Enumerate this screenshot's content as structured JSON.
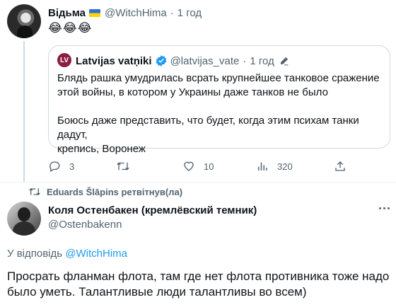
{
  "tweet": {
    "author_name": "Відьма",
    "handle": "@WitchHima",
    "dot": "·",
    "time": "1 год",
    "text": "😂😂😂",
    "quote": {
      "avatar_text": "LV",
      "author_name": "Latvijas vatņiki",
      "handle": "@latvijas_vate",
      "dot": "·",
      "time": "1 год",
      "text": "Блядь рашка умудрилась всрать крупнейшее танковое сражение\nэтой войны, в котором у Украины даже танков не было\n\nБоюсь даже представить, что будет, когда этим психам танки дадут,\nкрепись, Воронеж"
    },
    "actions": {
      "replies": "3",
      "retweets": "",
      "likes": "10",
      "views": "320"
    }
  },
  "retweet": {
    "retweeted_by": "Eduards Šlāpins ретвітнув(ла)",
    "author_name": "Коля Остенбакен (кремлёвский темник)",
    "handle": "@Ostenbakenn",
    "reply_prefix": "У відповідь",
    "reply_to": "@WitchHima",
    "text": "Просрать фланман флота, там где нет флота противника тоже надо было уметь. Талантливые люди талантливы во всем)"
  },
  "colors": {
    "text": "#0f1419",
    "secondary": "#536471",
    "accent": "#1d9bf0",
    "border": "#cfd9de"
  }
}
